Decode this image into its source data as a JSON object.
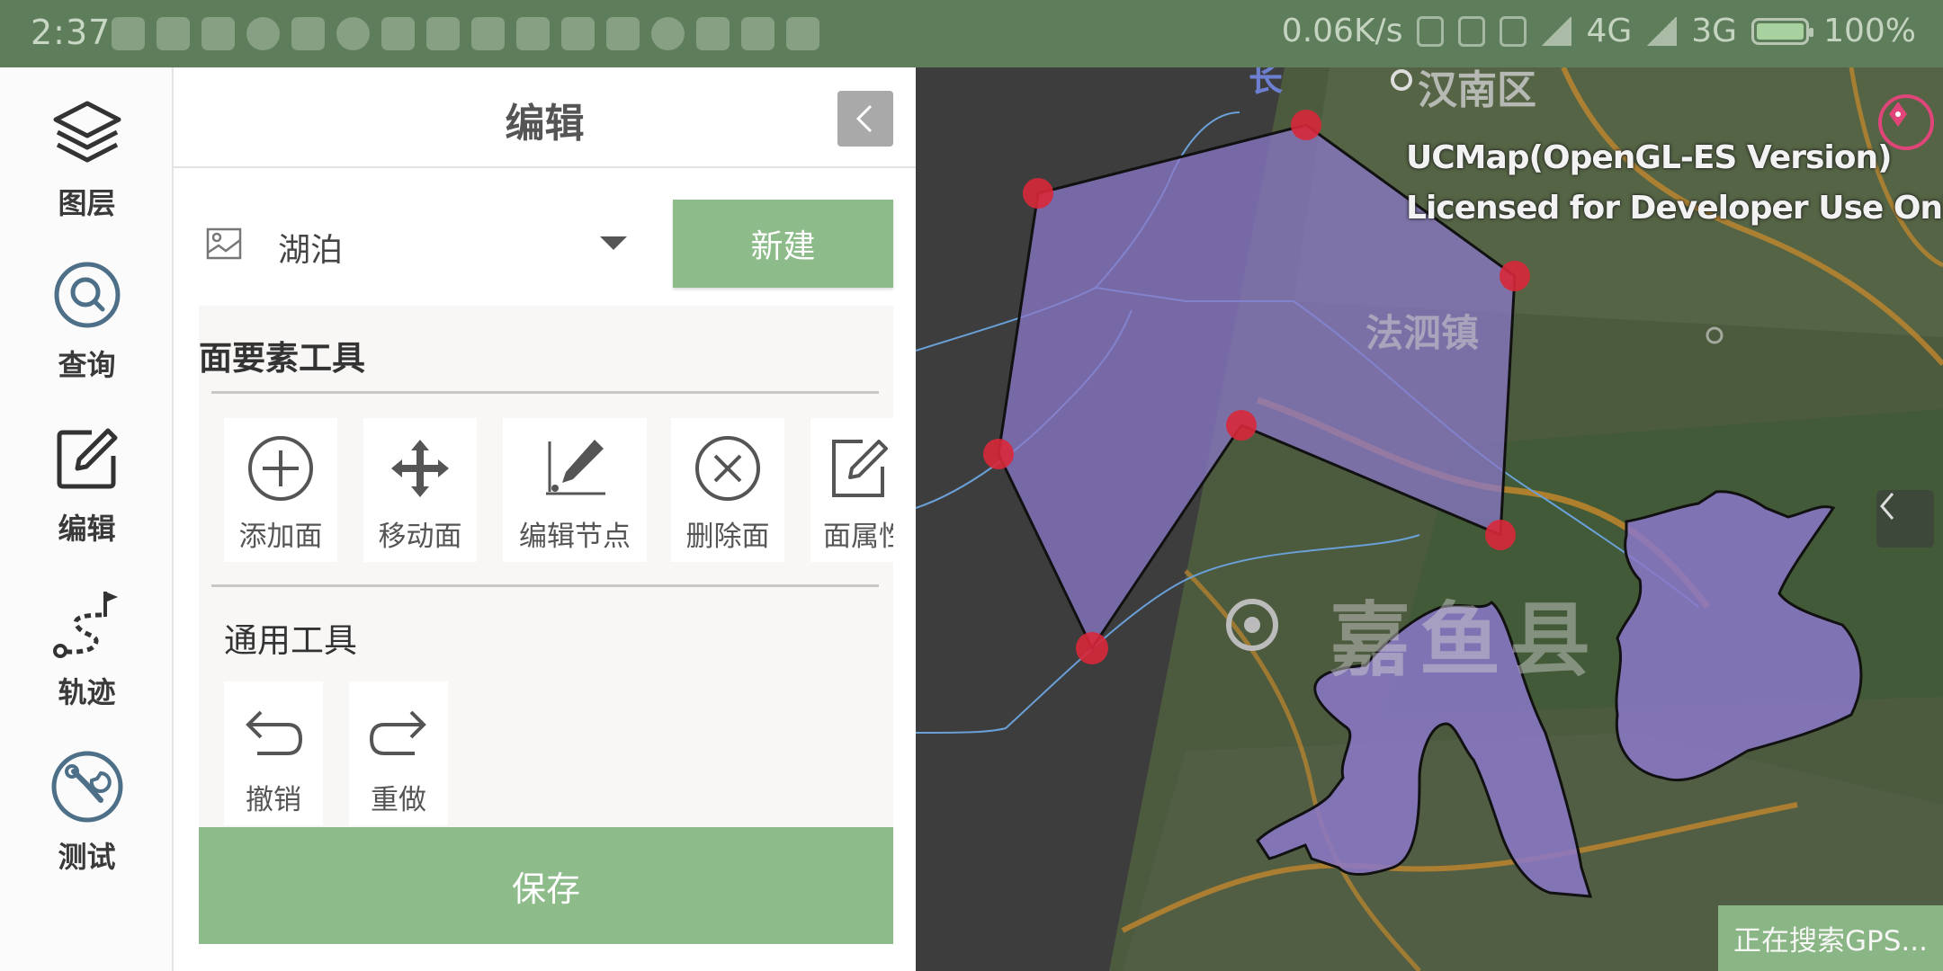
{
  "status_bar": {
    "time": "2:37",
    "net_speed": "0.06K/s",
    "network_4g": "4G",
    "network_3g": "3G",
    "battery": "100%"
  },
  "nav": {
    "items": [
      {
        "label": "图层",
        "icon": "layers-icon"
      },
      {
        "label": "查询",
        "icon": "search-icon"
      },
      {
        "label": "编辑",
        "icon": "edit-icon"
      },
      {
        "label": "轨迹",
        "icon": "track-icon"
      },
      {
        "label": "测试",
        "icon": "wrench-icon"
      }
    ]
  },
  "panel": {
    "title": "编辑",
    "layer_select": "湖泊",
    "new_button": "新建",
    "section_polygon_tools": "面要素工具",
    "polygon_tools": [
      {
        "label": "添加面",
        "icon": "add-circle-icon"
      },
      {
        "label": "移动面",
        "icon": "move-icon"
      },
      {
        "label": "编辑节点",
        "icon": "edit-node-icon"
      },
      {
        "label": "删除面",
        "icon": "delete-circle-icon"
      },
      {
        "label": "面属性",
        "icon": "attribute-edit-icon"
      }
    ],
    "section_common_tools": "通用工具",
    "common_tools": [
      {
        "label": "撤销",
        "icon": "undo-icon"
      },
      {
        "label": "重做",
        "icon": "redo-icon"
      }
    ],
    "save_button": "保存"
  },
  "map": {
    "watermark_line1": "UCMap(OpenGL-ES Version)",
    "watermark_line2": "Licensed for Developer Use Only",
    "place_label_1": "汉南区",
    "place_label_2": "法泗镇",
    "place_label_3": "嘉鱼县",
    "place_label_4": "长",
    "gps_status": "正在搜索GPS...",
    "polygon_color": "#8b78c9",
    "vertex_color": "#d8283a"
  }
}
